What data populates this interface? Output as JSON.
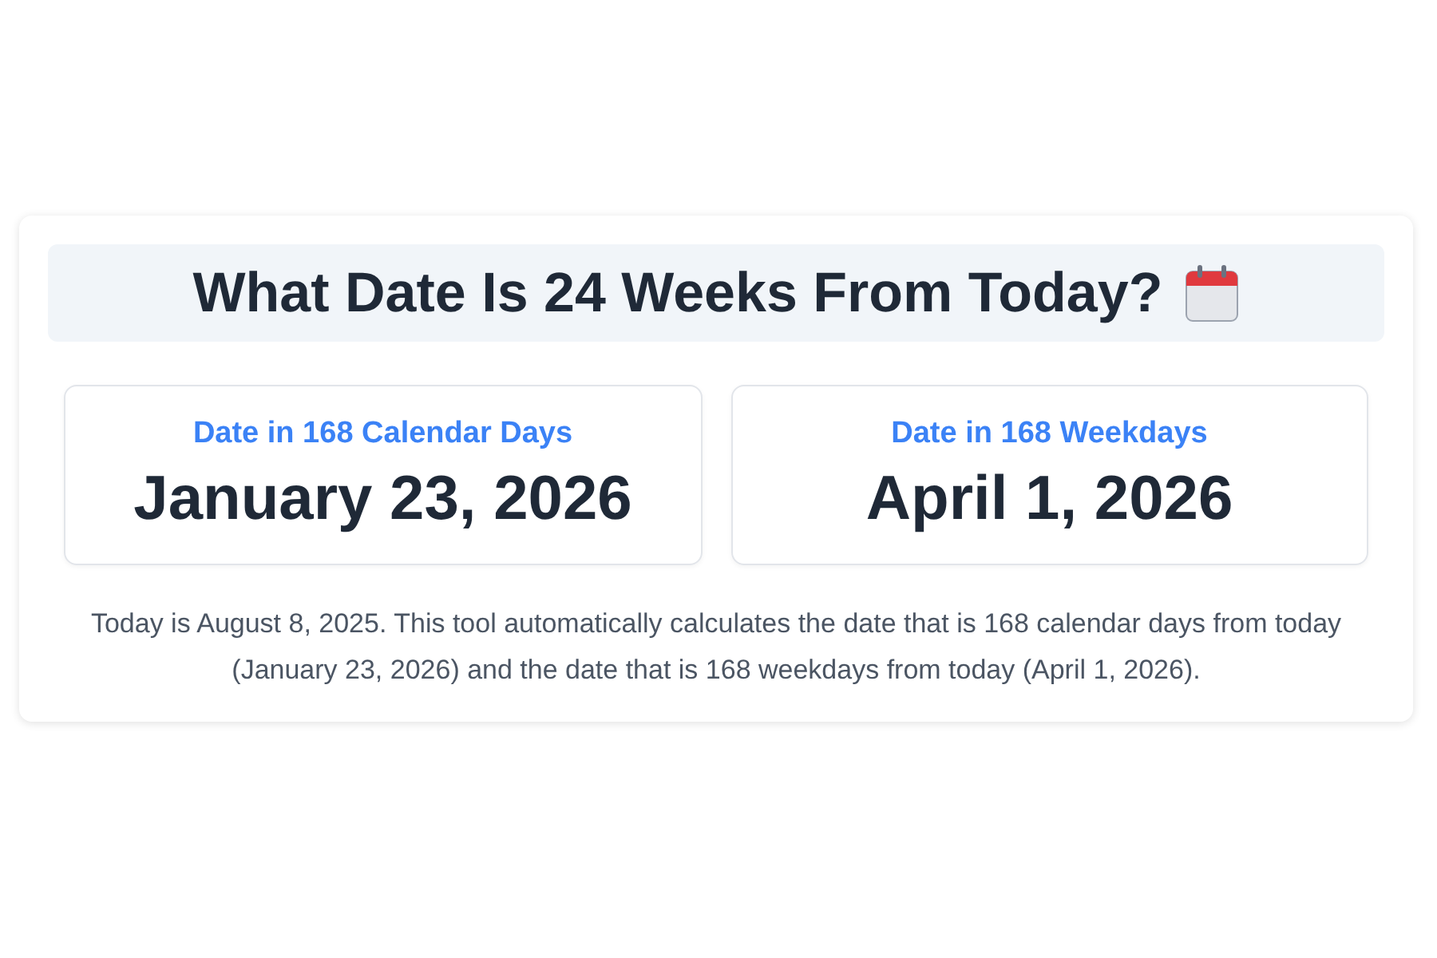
{
  "title": "What Date Is 24 Weeks From Today?",
  "results": [
    {
      "label": "Date in 168 Calendar Days",
      "date": "January 23, 2026"
    },
    {
      "label": "Date in 168 Weekdays",
      "date": "April 1, 2026"
    }
  ],
  "description": "Today is August 8, 2025. This tool automatically calculates the date that is 168 calendar days from today (January 23, 2026) and the date that is 168 weekdays from today (April 1, 2026)."
}
